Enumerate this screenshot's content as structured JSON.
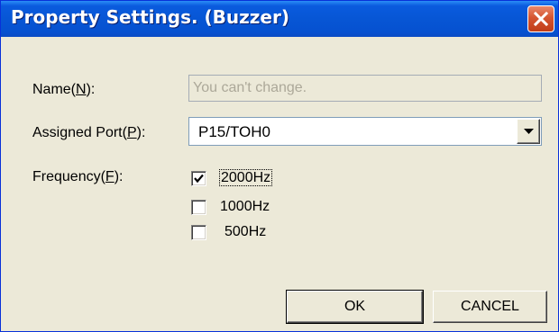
{
  "window": {
    "title": "Property Settings. (Buzzer)"
  },
  "form": {
    "name": {
      "label_prefix": "Name(",
      "label_key": "N",
      "label_suffix": "):",
      "placeholder": "You can't change.",
      "value": ""
    },
    "assigned_port": {
      "label_prefix": "Assigned Port(",
      "label_key": "P",
      "label_suffix": "):",
      "selected": "P15/TOH0"
    },
    "frequency": {
      "label_prefix": "Frequency(",
      "label_key": "F",
      "label_suffix": "):",
      "options": [
        {
          "label": "2000Hz",
          "checked": true,
          "focused": true
        },
        {
          "label": "1000Hz",
          "checked": false,
          "focused": false
        },
        {
          "label": "500Hz",
          "checked": false,
          "focused": false
        }
      ]
    }
  },
  "buttons": {
    "ok": "OK",
    "cancel": "CANCEL"
  },
  "icons": {
    "close": "close-icon",
    "dropdown": "chevron-down-icon",
    "check": "check-icon"
  },
  "colors": {
    "titlebar": "#0756d5",
    "close_button": "#d55531",
    "dialog_bg": "#ece9d8",
    "disabled_text": "#aca899"
  }
}
